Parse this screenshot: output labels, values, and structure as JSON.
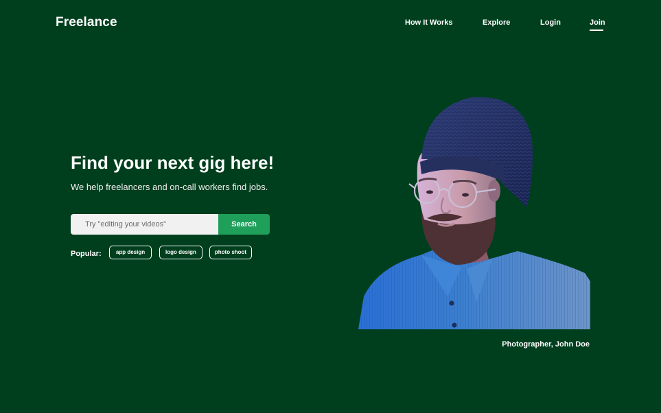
{
  "brand": {
    "name": "Freelance"
  },
  "nav": {
    "items": [
      {
        "label": "How It Works"
      },
      {
        "label": "Explore"
      },
      {
        "label": "Login"
      },
      {
        "label": "Join"
      }
    ]
  },
  "hero": {
    "title": "Find your next gig here!",
    "subtitle": "We help freelancers and on-call workers find jobs.",
    "search": {
      "placeholder": "Try \"editing your videos\"",
      "value": "",
      "button_label": "Search"
    },
    "popular": {
      "label": "Popular:",
      "tags": [
        "app design",
        "logo design",
        "photo shoot"
      ]
    }
  },
  "photo": {
    "caption": "Photographer, John Doe"
  },
  "colors": {
    "background": "#003f1e",
    "accent": "#1fa05a",
    "input_bg": "#f1f1f1",
    "text": "#ffffff"
  },
  "icons": {
    "photo": "person-portrait"
  }
}
